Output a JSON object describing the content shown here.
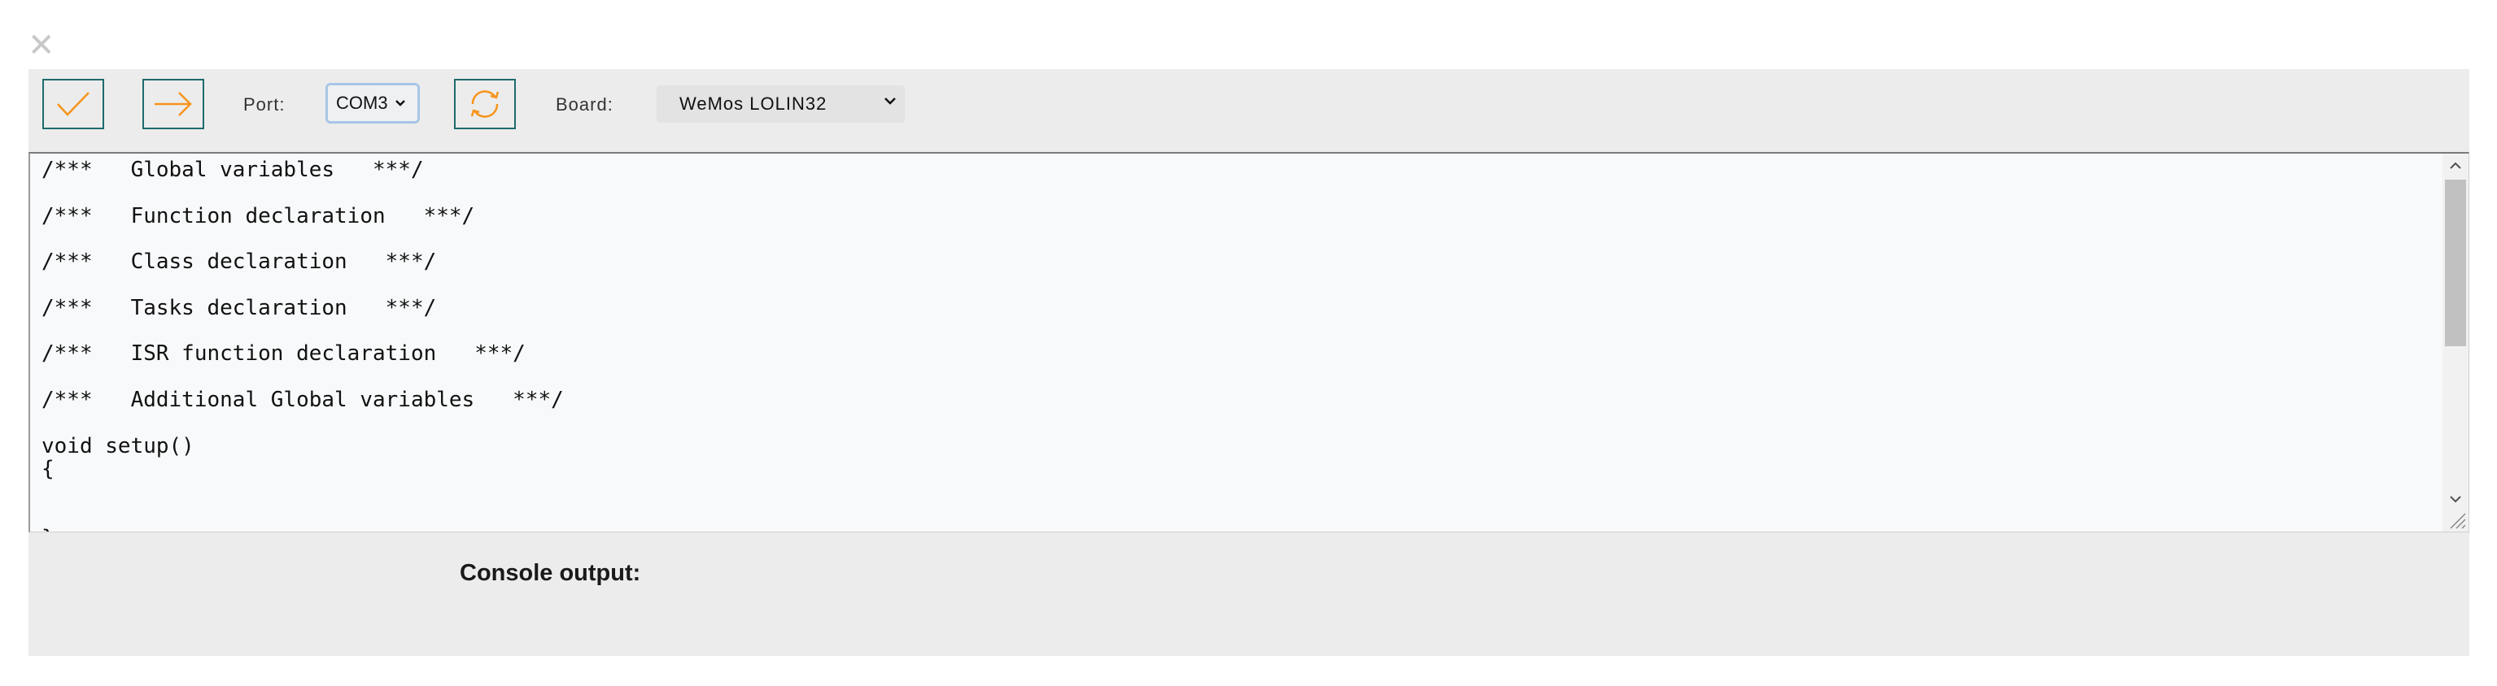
{
  "window": {
    "close_icon": "close-icon"
  },
  "toolbar": {
    "verify_icon": "checkmark-icon",
    "upload_icon": "arrow-right-icon",
    "refresh_icon": "refresh-icon",
    "port_label": "Port:",
    "port_value": "COM3",
    "board_label": "Board:",
    "board_value": "WeMos LOLIN32",
    "accent_color": "#f7941d",
    "border_color": "#1f6b6b"
  },
  "editor": {
    "lines": [
      "/***   Global variables   ***/",
      "",
      "/***   Function declaration   ***/",
      "",
      "/***   Class declaration   ***/",
      "",
      "/***   Tasks declaration   ***/",
      "",
      "/***   ISR function declaration   ***/",
      "",
      "/***   Additional Global variables   ***/",
      "",
      "void setup()",
      "{",
      "",
      "",
      "}"
    ]
  },
  "console": {
    "title": "Console output:"
  }
}
